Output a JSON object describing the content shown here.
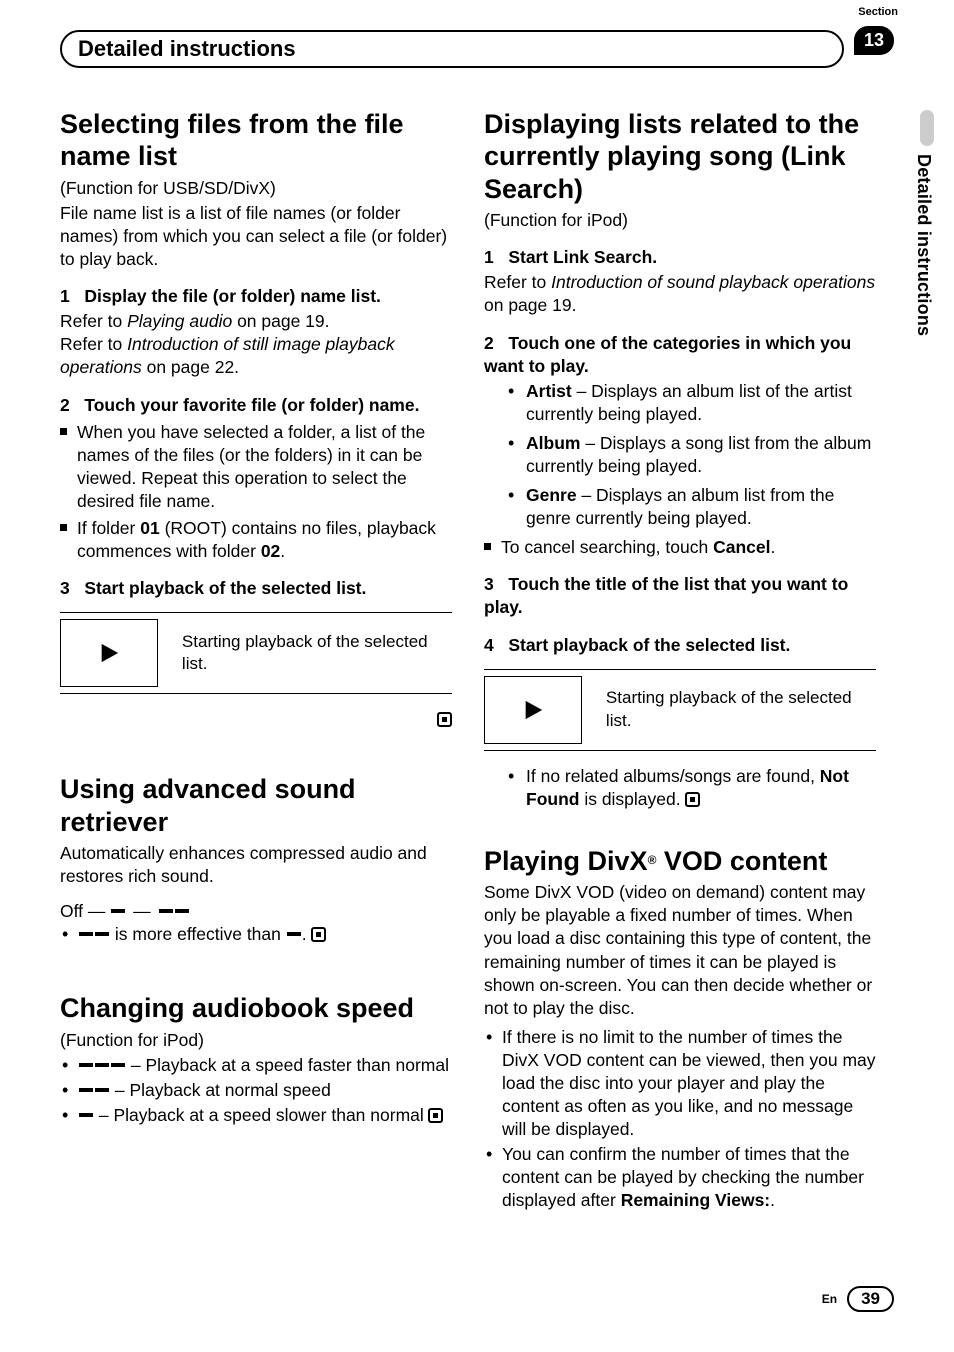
{
  "header": {
    "title": "Detailed instructions",
    "section_label": "Section",
    "section_number": "13",
    "side_tab": "Detailed instructions"
  },
  "footer": {
    "lang": "En",
    "page": "39"
  },
  "left": {
    "sec1": {
      "title": "Selecting files from the file name list",
      "func": "(Function for USB/SD/DivX)",
      "intro": "File name list is a list of file names (or folder names) from which you can select a file (or folder) to play back.",
      "step1_num": "1",
      "step1": "Display the file (or folder) name list.",
      "ref1a_pre": "Refer to ",
      "ref1a_it": "Playing audio",
      "ref1a_post": " on page 19.",
      "ref1b_pre": "Refer to ",
      "ref1b_it": "Introduction of still image playback operations",
      "ref1b_post": " on page 22.",
      "step2_num": "2",
      "step2": "Touch your favorite file (or folder) name.",
      "b1": "When you have selected a folder, a list of the names of the files (or the folders) in it can be viewed. Repeat this operation to select the desired file name.",
      "b2a": "If folder ",
      "b2b": "01",
      "b2c": " (ROOT) contains no files, playback commences with folder ",
      "b2d": "02",
      "b2e": ".",
      "step3_num": "3",
      "step3": "Start playback of the selected list.",
      "play_desc": "Starting playback of the selected list."
    },
    "sec2": {
      "title": "Using advanced sound retriever",
      "intro": "Automatically enhances compressed audio and restores rich sound.",
      "off": "Off —",
      "dash": "—",
      "e1": " is more effective than ",
      "e2": "."
    },
    "sec3": {
      "title": "Changing audiobook speed",
      "func": "(Function for iPod)",
      "i1": " – Playback at a speed faster than normal",
      "i2": " – Playback at normal speed",
      "i3": " – Playback at a speed slower than normal"
    }
  },
  "right": {
    "sec1": {
      "title": "Displaying lists related to the currently playing song (Link Search)",
      "func": "(Function for iPod)",
      "step1_num": "1",
      "step1": "Start Link Search.",
      "ref1_pre": "Refer to ",
      "ref1_it": "Introduction of sound playback operations",
      "ref1_post": " on page 19.",
      "step2_num": "2",
      "step2": "Touch one of the categories in which you want to play.",
      "artist_l": "Artist",
      "artist_t": " – Displays an album list of the artist currently being played.",
      "album_l": "Album",
      "album_t": " – Displays a song list from the album currently being played.",
      "genre_l": "Genre",
      "genre_t": " – Displays an album list from the genre currently being played.",
      "cancel_pre": "To cancel searching, touch ",
      "cancel_b": "Cancel",
      "cancel_post": ".",
      "step3_num": "3",
      "step3": "Touch the title of the list that you want to play.",
      "step4_num": "4",
      "step4": "Start playback of the selected list.",
      "play_desc": "Starting playback of the selected list.",
      "nf_pre": "If no related albums/songs are found, ",
      "nf_b": "Not Found",
      "nf_post": " is displayed."
    },
    "sec2": {
      "title_a": "Playing DivX",
      "title_b": " VOD content",
      "intro": "Some DivX VOD (video on demand) content may only be playable a fixed number of times. When you load a disc containing this type of content, the remaining number of times it can be played is shown on-screen. You can then decide whether or not to play the disc.",
      "b1": "If there is no limit to the number of times the DivX VOD content can be viewed, then you may load the disc into your player and play the content as often as you like, and no message will be displayed.",
      "b2_pre": "You can confirm the number of times that the content can be played by checking the number displayed after ",
      "b2_b": "Remaining Views:",
      "b2_post": "."
    }
  }
}
